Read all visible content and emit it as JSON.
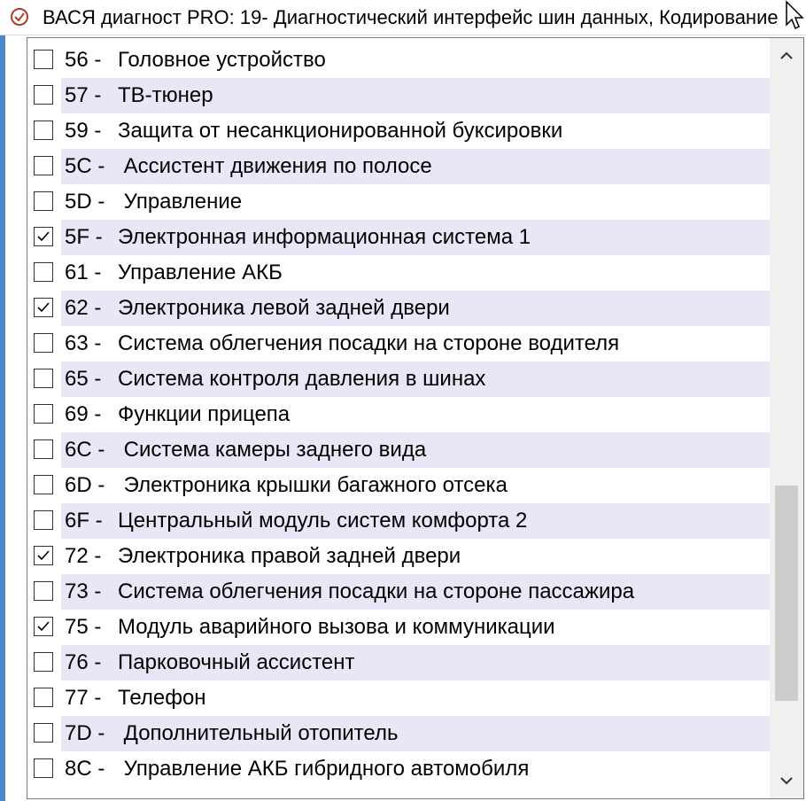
{
  "window": {
    "title": "ВАСЯ диагност PRO: 19- Диагностический интерфейс шин данных,  Кодирование"
  },
  "icons": {
    "app": "app-logo-icon",
    "cursor": "mouse-cursor-icon",
    "check": "checkmark-icon",
    "up": "chevron-up-icon",
    "down": "chevron-down-icon"
  },
  "colors": {
    "alt_row": "#e7e7f5",
    "accent_left": "#4a86c8",
    "scroll_thumb": "#cdcdcd"
  },
  "scroll": {
    "position": 0.72
  },
  "items": [
    {
      "code": "56 -",
      "name": "Головное устройство",
      "checked": false
    },
    {
      "code": "57 -",
      "name": "ТВ-тюнер",
      "checked": false
    },
    {
      "code": "59 -",
      "name": "Защита от несанкционированной буксировки",
      "checked": false
    },
    {
      "code": "5C -",
      "name": " Ассистент движения по полосе",
      "checked": false
    },
    {
      "code": "5D -",
      "name": " Управление",
      "checked": false
    },
    {
      "code": "5F -",
      "name": "Электронная информационная система 1",
      "checked": true
    },
    {
      "code": "61 -",
      "name": "Управление АКБ",
      "checked": false
    },
    {
      "code": "62 -",
      "name": "Электроника левой задней двери",
      "checked": true
    },
    {
      "code": "63 -",
      "name": "Система облегчения посадки на стороне водителя",
      "checked": false
    },
    {
      "code": "65 -",
      "name": "Система контроля давления в шинах",
      "checked": false
    },
    {
      "code": "69 -",
      "name": "Функции прицепа",
      "checked": false
    },
    {
      "code": "6C -",
      "name": " Система камеры заднего вида",
      "checked": false
    },
    {
      "code": "6D -",
      "name": " Электроника крышки багажного отсека",
      "checked": false
    },
    {
      "code": "6F -",
      "name": "Центральный модуль систем комфорта 2",
      "checked": false
    },
    {
      "code": "72 -",
      "name": "Электроника правой задней двери",
      "checked": true
    },
    {
      "code": "73 -",
      "name": "Система облегчения посадки на стороне пассажира",
      "checked": false
    },
    {
      "code": "75 -",
      "name": "Модуль аварийного вызова и коммуникации",
      "checked": true
    },
    {
      "code": "76 -",
      "name": "Парковочный ассистент",
      "checked": false
    },
    {
      "code": "77 -",
      "name": "Телефон",
      "checked": false
    },
    {
      "code": "7D -",
      "name": " Дополнительный отопитель",
      "checked": false
    },
    {
      "code": "8C -",
      "name": " Управление АКБ гибридного автомобиля",
      "checked": false
    }
  ]
}
